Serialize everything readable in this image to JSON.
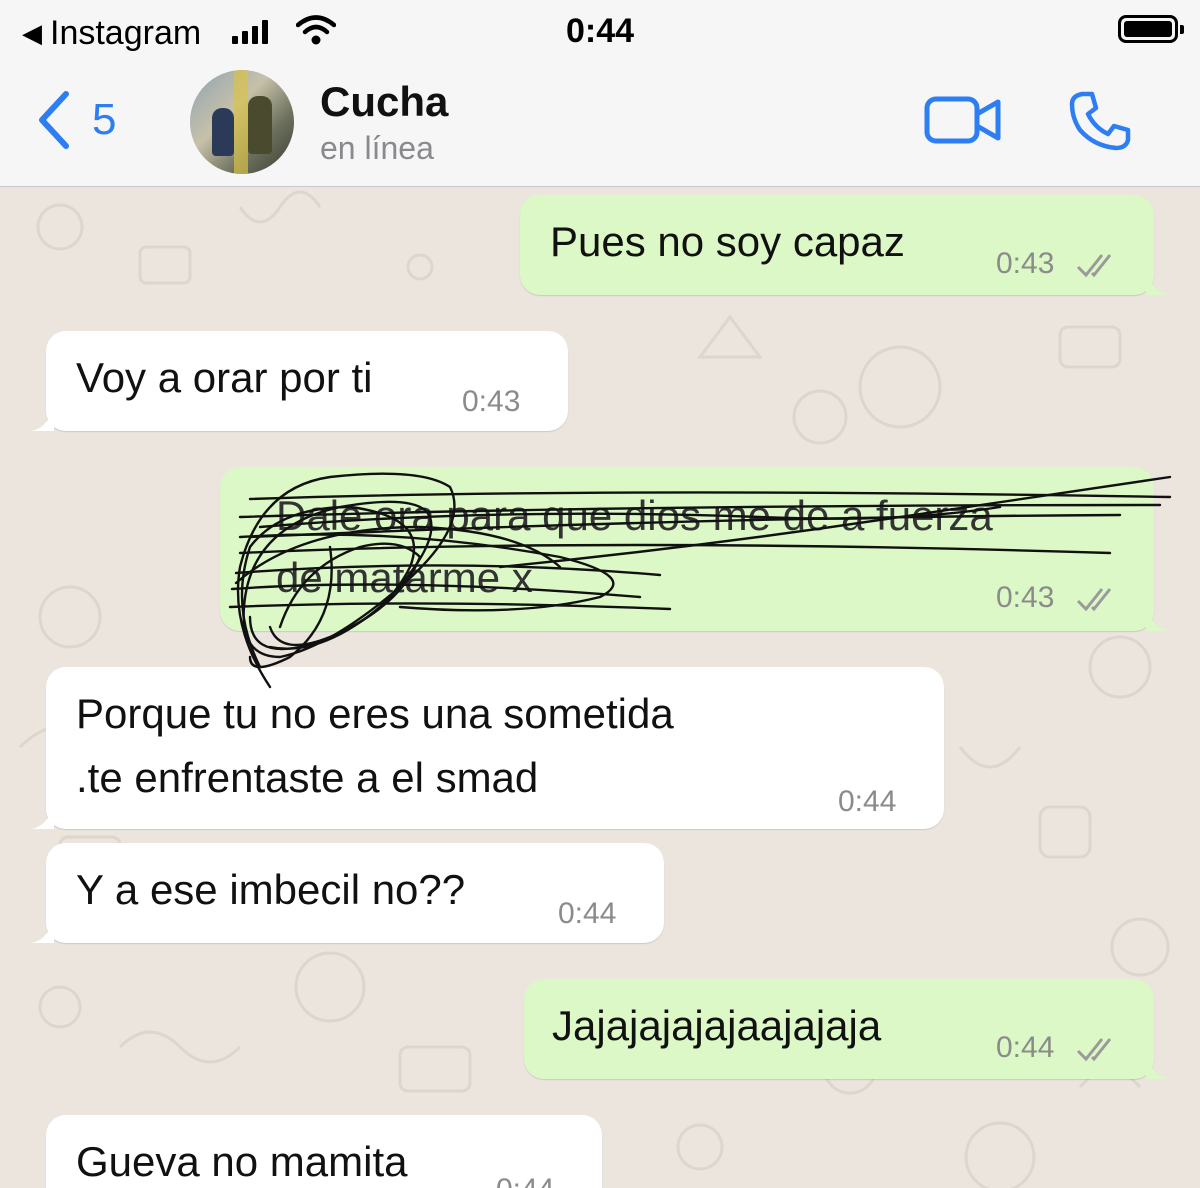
{
  "status_bar": {
    "back_app": "Instagram",
    "time": "0:44"
  },
  "header": {
    "back_count": "5",
    "contact_name": "Cucha",
    "contact_status": "en línea"
  },
  "messages": [
    {
      "direction": "out",
      "text": "Pues no soy capaz",
      "time": "0:43",
      "read": true
    },
    {
      "direction": "in",
      "text": "Voy a orar por ti",
      "time": "0:43"
    },
    {
      "direction": "out",
      "text": "Dale ora para que dios me de a fuerza",
      "text_line2": "de matarme x",
      "time": "0:43",
      "read": true,
      "scribbled_out": true
    },
    {
      "direction": "in",
      "text": "Porque tu no eres una sometida",
      "text_line2": ".te enfrentaste a el smad",
      "time": "0:44"
    },
    {
      "direction": "in",
      "text": "Y a ese imbecil no??",
      "time": "0:44"
    },
    {
      "direction": "out",
      "text": "Jajajajajajaajajaja",
      "time": "0:44",
      "read": true
    },
    {
      "direction": "in",
      "text": "Gueva no mamita",
      "time": "0:44"
    }
  ],
  "colors": {
    "accent": "#2c7ef2",
    "outgoing_bubble": "#dcf8c6",
    "incoming_bubble": "#ffffff",
    "chat_background": "#ebe5de",
    "read_ticks": "#9a9a9a"
  },
  "icons": [
    "back-chevron-icon",
    "video-call-icon",
    "phone-call-icon",
    "double-check-icon",
    "signal-icon",
    "wifi-icon",
    "battery-icon"
  ]
}
